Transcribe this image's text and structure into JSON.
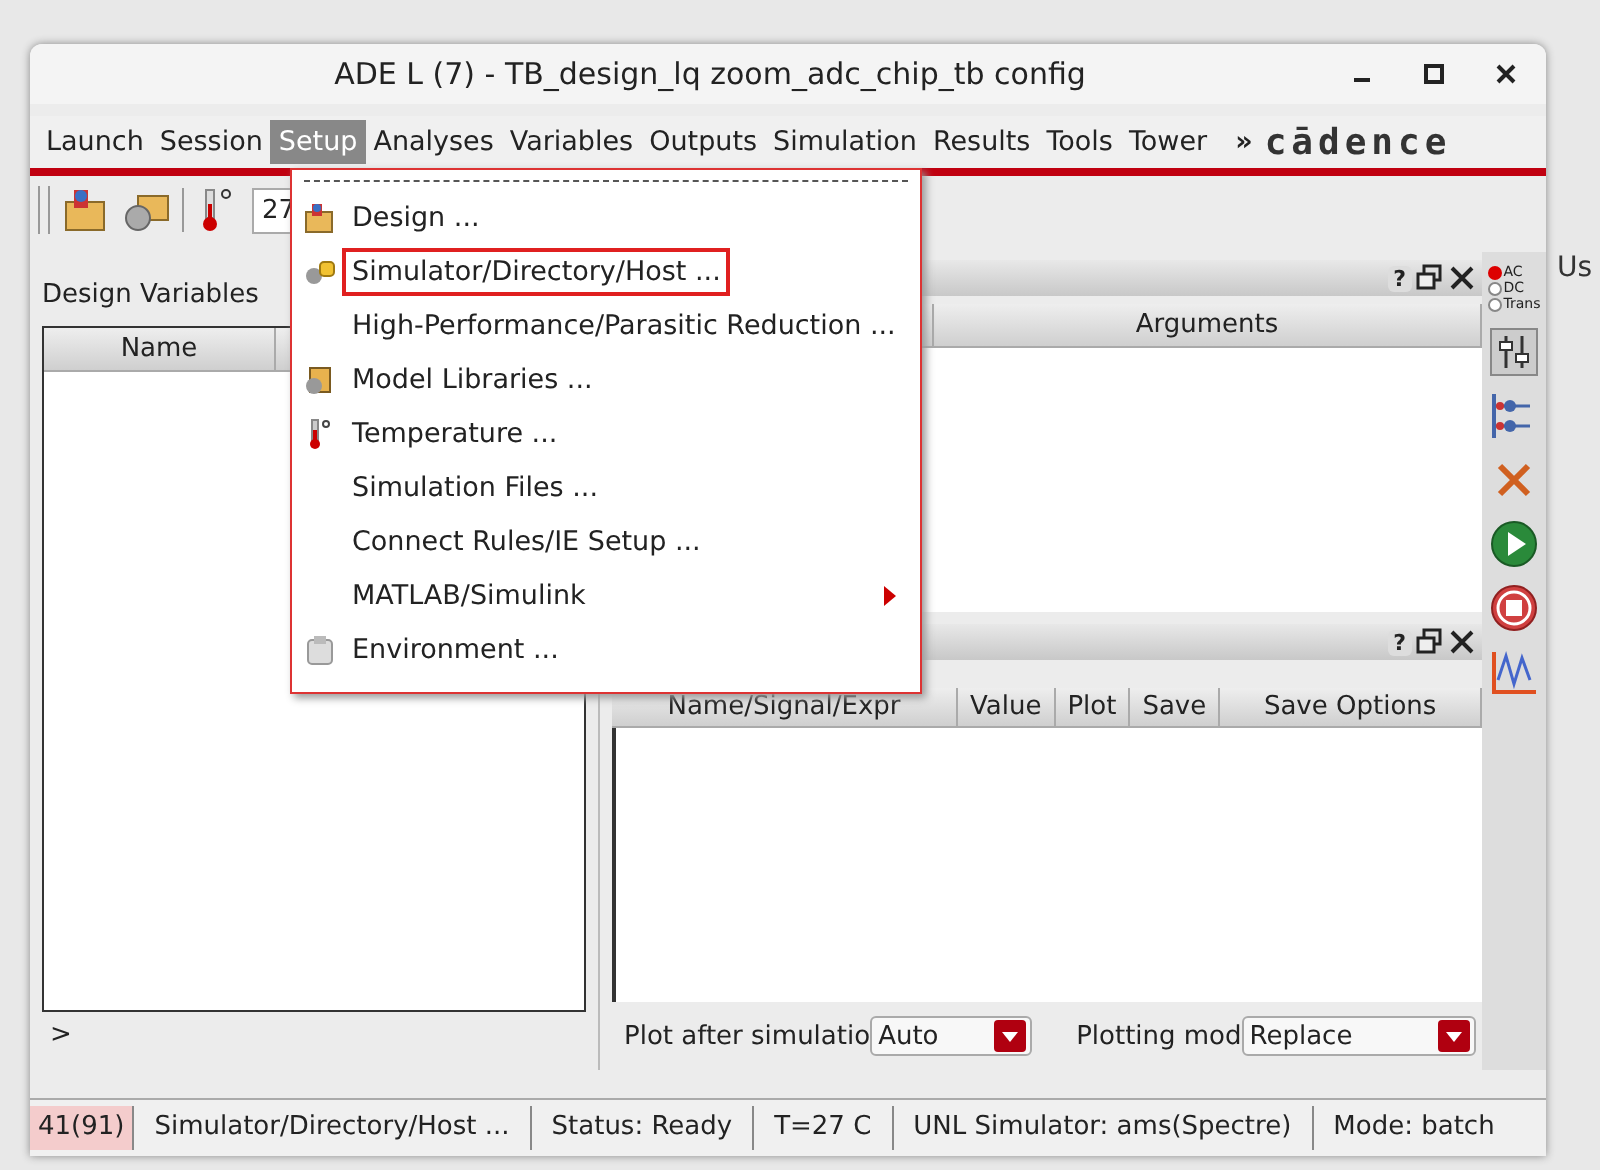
{
  "window": {
    "title": "ADE L (7) - TB_design_lq zoom_adc_chip_tb config"
  },
  "background": {
    "text": "Us"
  },
  "menu_bar": {
    "items": [
      {
        "label": "Launch",
        "selected": false
      },
      {
        "label": "Session",
        "selected": false
      },
      {
        "label": "Setup",
        "selected": true
      },
      {
        "label": "Analyses",
        "selected": false
      },
      {
        "label": "Variables",
        "selected": false
      },
      {
        "label": "Outputs",
        "selected": false
      },
      {
        "label": "Simulation",
        "selected": false
      },
      {
        "label": "Results",
        "selected": false
      },
      {
        "label": "Tools",
        "selected": false
      },
      {
        "label": "Tower",
        "selected": false
      }
    ],
    "overflow": "»",
    "logo": "cādence"
  },
  "toolbar": {
    "temperature": "27"
  },
  "setup_menu": {
    "items": [
      {
        "label": "Design ...",
        "kind": "design",
        "submenu": false,
        "annotated": false
      },
      {
        "label": "Simulator/Directory/Host ...",
        "kind": "simulator",
        "submenu": false,
        "annotated": true
      },
      {
        "label": "High-Performance/Parasitic Reduction ...",
        "kind": "plain",
        "submenu": false,
        "annotated": false
      },
      {
        "label": "Model Libraries ...",
        "kind": "library",
        "submenu": false,
        "annotated": false
      },
      {
        "label": "Temperature ...",
        "kind": "temperature",
        "submenu": false,
        "annotated": false
      },
      {
        "label": "Simulation Files ...",
        "kind": "plain",
        "submenu": false,
        "annotated": false
      },
      {
        "label": "Connect Rules/IE Setup ...",
        "kind": "plain",
        "submenu": false,
        "annotated": false
      },
      {
        "label": "MATLAB/Simulink",
        "kind": "plain",
        "submenu": true,
        "annotated": false
      },
      {
        "label": "Environment ...",
        "kind": "environment",
        "submenu": false,
        "annotated": false
      }
    ]
  },
  "design_variables": {
    "title": "Design Variables",
    "columns": [
      "Name"
    ],
    "expander": ">"
  },
  "analyses_panel": {
    "help": "?",
    "columns": [
      "Arguments"
    ]
  },
  "outputs_panel": {
    "help": "?",
    "columns": [
      "Name/Signal/Expr",
      "Value",
      "Plot",
      "Save",
      "Save Options"
    ],
    "plot_after_label": "Plot after simulatio",
    "plot_after_value": "Auto",
    "plotting_mode_label": "Plotting mod",
    "plotting_mode_value": "Replace"
  },
  "analysis_choice": [
    {
      "label": "AC",
      "selected": true
    },
    {
      "label": "DC",
      "selected": false
    },
    {
      "label": "Trans",
      "selected": false
    }
  ],
  "status_bar": [
    {
      "text": "41(91)",
      "kind": "counter"
    },
    {
      "text": "Simulator/Directory/Host ...",
      "kind": "plain"
    },
    {
      "text": "Status: Ready",
      "kind": "plain"
    },
    {
      "text": "T=27 C",
      "kind": "plain"
    },
    {
      "text": "UNL Simulator: ams(Spectre)",
      "kind": "plain"
    },
    {
      "text": "Mode: batch",
      "kind": "plain"
    }
  ]
}
